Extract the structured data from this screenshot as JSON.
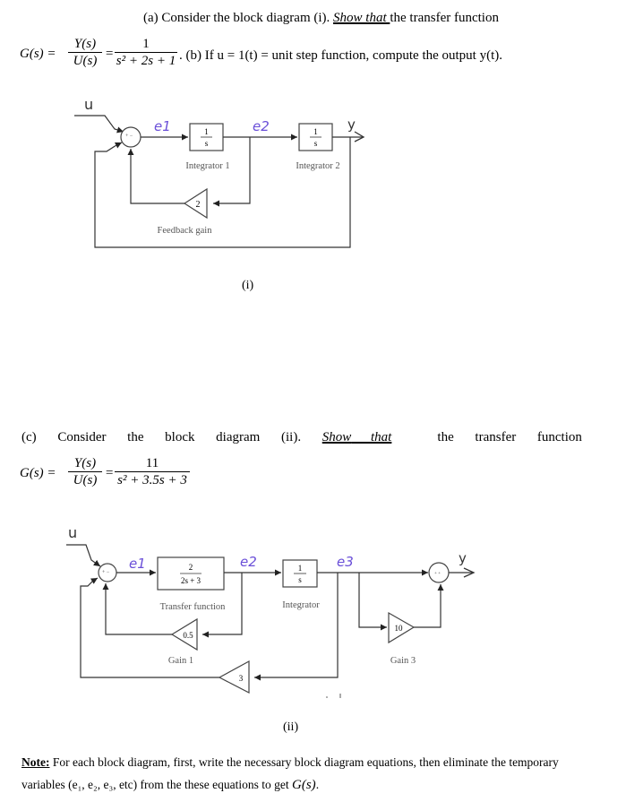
{
  "part_a": {
    "prefix": "(a) Consider the block diagram (i).",
    "emphasis": "Show that ",
    "suffix": "the transfer function"
  },
  "eq1": {
    "lhs": "G(s) =",
    "frac1_num": "Y(s)",
    "frac1_den": "U(s)",
    "equals": "=",
    "frac2_num": "1",
    "frac2_den": "s² + 2s + 1",
    "part_b": ". (b) If u = 1(t) = unit step function, compute the output y(t)."
  },
  "diagram_i": {
    "input_label": "u",
    "output_label": "y",
    "signal_e1": "e1",
    "signal_e2": "e2",
    "sum_signs": "+ − −",
    "block1": {
      "num": "1",
      "den": "s",
      "name": "Integrator 1"
    },
    "block2": {
      "num": "1",
      "den": "s",
      "name": "Integrator 2"
    },
    "gain": {
      "value": "2",
      "name": "Feedback gain"
    },
    "caption": "(i)"
  },
  "part_c": {
    "words": [
      "(c)",
      "Consider",
      "the",
      "block",
      "diagram",
      "(ii)."
    ],
    "emphasis": [
      "Show",
      "that"
    ],
    "suffix_words": [
      "the",
      "transfer",
      "function"
    ]
  },
  "eq2": {
    "lhs": "G(s) =",
    "frac1_num": "Y(s)",
    "frac1_den": "U(s)",
    "equals": "=",
    "frac2_num": "11",
    "frac2_den": "s² + 3.5s + 3"
  },
  "diagram_ii": {
    "input_label": "u",
    "output_label": "y",
    "signal_e1": "e1",
    "signal_e2": "e2",
    "signal_e3": "e3",
    "block_tf": {
      "num": "2",
      "den": "2s + 3",
      "name": "Transfer function"
    },
    "block_int": {
      "num": "1",
      "den": "s",
      "name": "Integrator"
    },
    "gain1": {
      "value": "0.5",
      "name": "Gain 1"
    },
    "gain2": {
      "value": "3"
    },
    "gain3": {
      "value": "10",
      "name": "Gain 3"
    },
    "caption": "(ii)"
  },
  "note": {
    "label": "Note:",
    "line1": " For each block diagram, first, write the necessary block diagram equations, then eliminate the temporary",
    "line2": "variables (e₁, e₂, e₃,  etc) from the these equations to get ",
    "line2_math": "G(s)",
    "line2_end": "."
  }
}
